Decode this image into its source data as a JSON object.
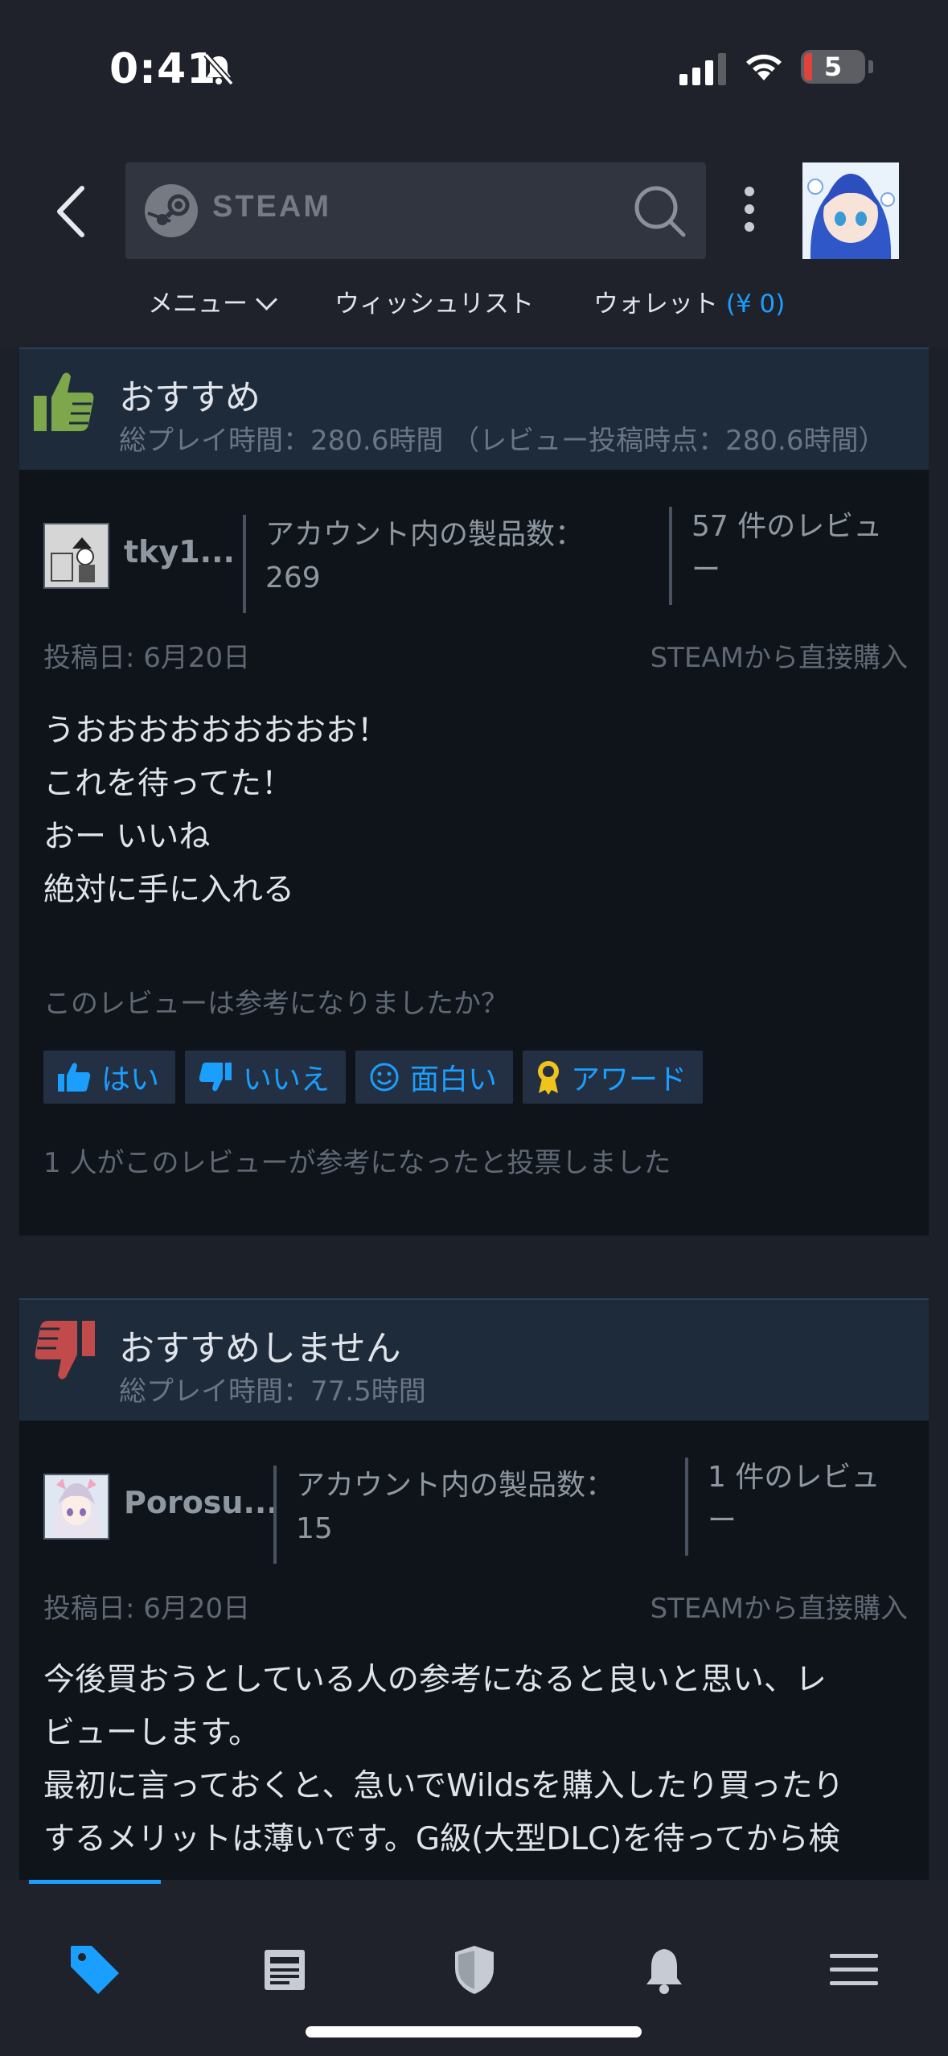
{
  "status": {
    "time": "0:41",
    "battery": "5"
  },
  "header": {
    "search_logo_text": "STEAM",
    "nav": {
      "menu": "メニュー",
      "wishlist": "ウィッシュリスト",
      "wallet_label": "ウォレット",
      "wallet_amount": "(¥ 0)"
    }
  },
  "reviews": [
    {
      "recommendation": "おすすめ",
      "play_time": "総プレイ時間：280.6時間 （レビュー投稿時点：280.6時間）",
      "reviewer_name": "tky1...",
      "products": "アカウント内の製品数：269",
      "products_line1": "アカウント内の製品数：",
      "products_line2": "269",
      "reviews_line1": "57 件のレビュ",
      "reviews_line2": "ー",
      "posted": "投稿日: 6月20日",
      "purchase": "STEAMから直接購入",
      "text": [
        "うおおおおおおおおお！",
        "これを待ってた！",
        "おー いいね",
        "絶対に手に入れる"
      ],
      "helpful_question": "このレビューは参考になりましたか？",
      "votes": {
        "yes": "はい",
        "no": "いいえ",
        "funny": "面白い",
        "award": "アワード"
      },
      "vote_count": "1 人がこのレビューが参考になったと投票しました"
    },
    {
      "recommendation": "おすすめしません",
      "play_time": "総プレイ時間：77.5時間",
      "reviewer_name": "Porosu...",
      "products_line1": "アカウント内の製品数：",
      "products_line2": "15",
      "reviews_line1": "1 件のレビュ",
      "reviews_line2": "ー",
      "posted": "投稿日: 6月20日",
      "purchase": "STEAMから直接購入",
      "text": [
        "今後買おうとしている人の参考になると良いと思い、レ",
        "ビューします。",
        "最初に言っておくと、急いでWildsを購入したり買ったり",
        "するメリットは薄いです。G級(大型DLC)を待ってから検"
      ]
    }
  ],
  "tabbar": {
    "icons": [
      "store-tag-icon",
      "news-icon",
      "shield-icon",
      "bell-icon",
      "menu-icon"
    ],
    "active_color": "#1a9fff"
  }
}
